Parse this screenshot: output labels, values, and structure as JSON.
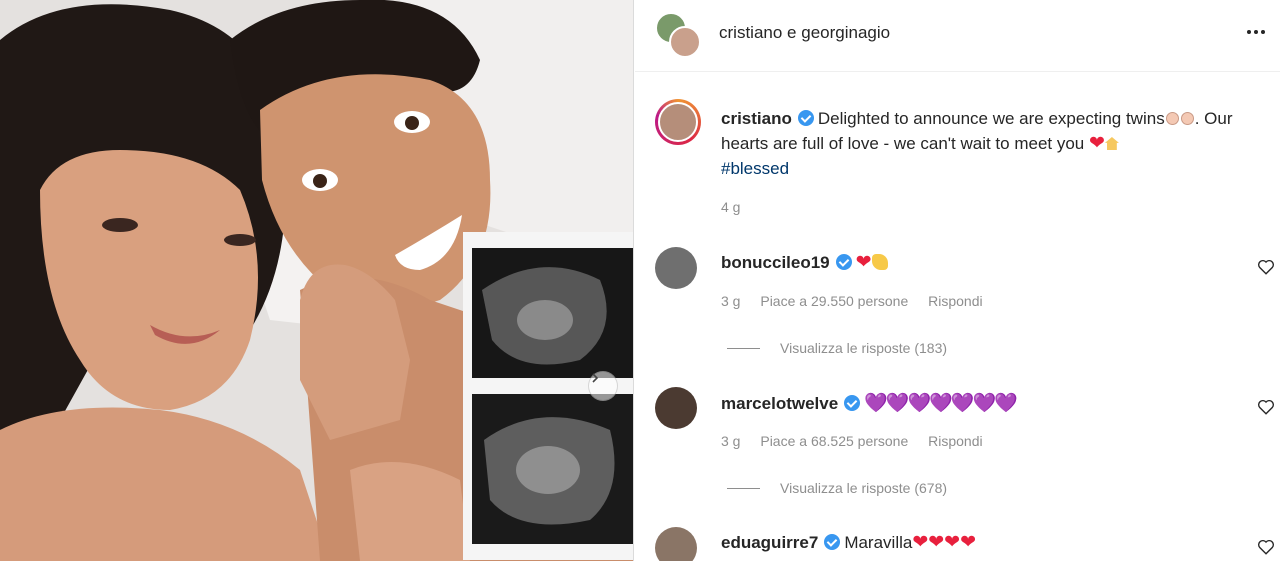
{
  "header": {
    "user1": "cristiano",
    "connector": "e",
    "user2": "georginagio",
    "more_icon": "more-horizontal-icon"
  },
  "caption": {
    "username": "cristiano",
    "text_part1": "Delighted to announce we are expecting twins",
    "text_part2": ". Our hearts are full of love - we can't wait to meet you",
    "hashtag": "#blessed",
    "time": "4 g"
  },
  "comments": [
    {
      "username": "bonuccileo19",
      "text": "",
      "emoji": "heart-clap",
      "time": "3 g",
      "likes": "Piace a 29.550 persone",
      "reply": "Rispondi",
      "view_replies": "Visualizza le risposte (183)"
    },
    {
      "username": "marcelotwelve",
      "text": "💜💜💜💜💜💜💜",
      "time": "3 g",
      "likes": "Piace a 68.525 persone",
      "reply": "Rispondi",
      "view_replies": "Visualizza le risposte (678)"
    },
    {
      "username": "eduaguirre7",
      "text": "Maravilla",
      "hearts": "❤❤❤❤"
    }
  ],
  "colors": {
    "verified": "#3897f0",
    "hashtag": "#00376b",
    "heart": "#e8203d",
    "secondary_text": "#8e8e8e"
  }
}
